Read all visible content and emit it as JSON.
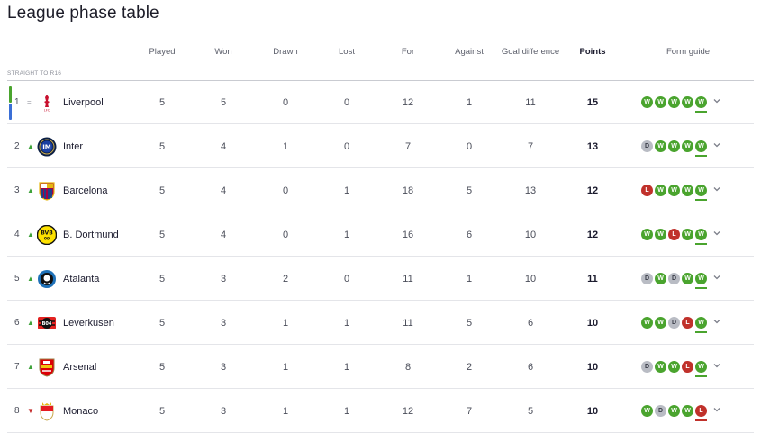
{
  "title": "League phase table",
  "section_label": "STRAIGHT TO R16",
  "columns": {
    "played": "Played",
    "won": "Won",
    "drawn": "Drawn",
    "lost": "Lost",
    "for": "For",
    "against": "Against",
    "goal_difference": "Goal difference",
    "points": "Points",
    "form_guide": "Form guide"
  },
  "colors": {
    "win": "#4aa42e",
    "loss": "#c0312b",
    "draw": "#b9bcc4",
    "up": "#3ea33a",
    "down": "#c42b2b"
  },
  "rows": [
    {
      "pos": "1",
      "move": "same",
      "move_glyph": "=",
      "team": "Liverpool",
      "badge": "liverpool-crest-icon",
      "played": "5",
      "won": "5",
      "drawn": "0",
      "lost": "0",
      "for": "12",
      "against": "1",
      "gd": "11",
      "pts": "15",
      "form": [
        "W",
        "W",
        "W",
        "W",
        "W"
      ]
    },
    {
      "pos": "2",
      "move": "up",
      "move_glyph": "▲",
      "team": "Inter",
      "badge": "inter-crest-icon",
      "played": "5",
      "won": "4",
      "drawn": "1",
      "lost": "0",
      "for": "7",
      "against": "0",
      "gd": "7",
      "pts": "13",
      "form": [
        "D",
        "W",
        "W",
        "W",
        "W"
      ]
    },
    {
      "pos": "3",
      "move": "up",
      "move_glyph": "▲",
      "team": "Barcelona",
      "badge": "barcelona-crest-icon",
      "played": "5",
      "won": "4",
      "drawn": "0",
      "lost": "1",
      "for": "18",
      "against": "5",
      "gd": "13",
      "pts": "12",
      "form": [
        "L",
        "W",
        "W",
        "W",
        "W"
      ]
    },
    {
      "pos": "4",
      "move": "up",
      "move_glyph": "▲",
      "team": "B. Dortmund",
      "badge": "dortmund-crest-icon",
      "played": "5",
      "won": "4",
      "drawn": "0",
      "lost": "1",
      "for": "16",
      "against": "6",
      "gd": "10",
      "pts": "12",
      "form": [
        "W",
        "W",
        "L",
        "W",
        "W"
      ]
    },
    {
      "pos": "5",
      "move": "up",
      "move_glyph": "▲",
      "team": "Atalanta",
      "badge": "atalanta-crest-icon",
      "played": "5",
      "won": "3",
      "drawn": "2",
      "lost": "0",
      "for": "11",
      "against": "1",
      "gd": "10",
      "pts": "11",
      "form": [
        "D",
        "W",
        "D",
        "W",
        "W"
      ]
    },
    {
      "pos": "6",
      "move": "up",
      "move_glyph": "▲",
      "team": "Leverkusen",
      "badge": "leverkusen-crest-icon",
      "played": "5",
      "won": "3",
      "drawn": "1",
      "lost": "1",
      "for": "11",
      "against": "5",
      "gd": "6",
      "pts": "10",
      "form": [
        "W",
        "W",
        "D",
        "L",
        "W"
      ]
    },
    {
      "pos": "7",
      "move": "up",
      "move_glyph": "▲",
      "team": "Arsenal",
      "badge": "arsenal-crest-icon",
      "played": "5",
      "won": "3",
      "drawn": "1",
      "lost": "1",
      "for": "8",
      "against": "2",
      "gd": "6",
      "pts": "10",
      "form": [
        "D",
        "W",
        "W",
        "L",
        "W"
      ]
    },
    {
      "pos": "8",
      "move": "down",
      "move_glyph": "▼",
      "team": "Monaco",
      "badge": "monaco-crest-icon",
      "played": "5",
      "won": "3",
      "drawn": "1",
      "lost": "1",
      "for": "12",
      "against": "7",
      "gd": "5",
      "pts": "10",
      "form": [
        "W",
        "D",
        "W",
        "W",
        "L"
      ]
    }
  ]
}
